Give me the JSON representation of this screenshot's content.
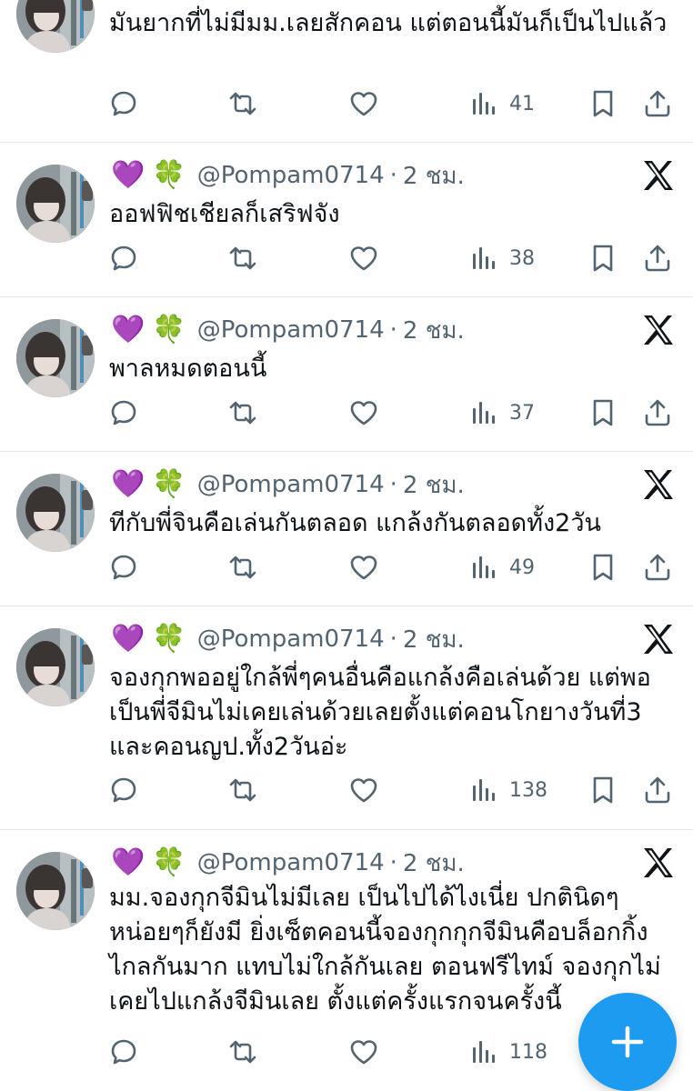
{
  "tweets": [
    {
      "text": "มันยากที่ไม่มีมม.เลยสักคอน แต่ตอนนี้มันก็เป็นไปแล้ว",
      "views": "41"
    },
    {
      "heart": "💜",
      "clover": "🍀",
      "handle": "@Pompam0714",
      "dot": "·",
      "time": "2 ชม.",
      "text": "ออฟฟิชเชียลก็เสริฟจัง",
      "views": "38"
    },
    {
      "heart": "💜",
      "clover": "🍀",
      "handle": "@Pompam0714",
      "dot": "·",
      "time": "2 ชม.",
      "text": "พาลหมดตอนนี้",
      "views": "37"
    },
    {
      "heart": "💜",
      "clover": "🍀",
      "handle": "@Pompam0714",
      "dot": "·",
      "time": "2 ชม.",
      "text": "ทีกับพี่จินคือเล่นกันตลอด แกล้งกันตลอดทั้ง2วัน",
      "views": "49"
    },
    {
      "heart": "💜",
      "clover": "🍀",
      "handle": "@Pompam0714",
      "dot": "·",
      "time": "2 ชม.",
      "text": "จองกุกพออยู่ใกล้พี่ๆคนอื่นคือแกล้งคือเล่นด้วย แต่พอเป็นพี่จีมินไม่เคยเล่นด้วยเลยตั้งแต่คอนโกยางวันที่3 และคอนญป.ทั้ง2วันอ่ะ",
      "views": "138"
    },
    {
      "heart": "💜",
      "clover": "🍀",
      "handle": "@Pompam0714",
      "dot": "·",
      "time": "2 ชม.",
      "text": "มม.จองกุกจีมินไม่มีเลย เป็นไปได้ไงเนี่ย ปกตินิดๆหน่อยๆก็ยังมี ยิ่งเซ็ตคอนนี้จองกุกกุกจีมินคือบล็อกกิ้งไกลกันมาก แทบไม่ใกล้กันเลย ตอนฟรีไทม์ จองกุกไม่เคยไปแกล้งจีมินเลย ตั้งแต่ครั้งแรกจนครั้งนี้",
      "views": "118"
    }
  ],
  "icons": {
    "reply": "reply-icon",
    "retweet": "retweet-icon",
    "like": "like-icon",
    "views": "views-icon",
    "bookmark": "bookmark-icon",
    "share": "share-icon",
    "x_logo": "x-logo-icon",
    "compose": "compose-plus-icon"
  },
  "colors": {
    "text": "#0f1419",
    "secondary": "#536471",
    "divider": "#e6e9ec",
    "fab": "#1d9bf0"
  }
}
